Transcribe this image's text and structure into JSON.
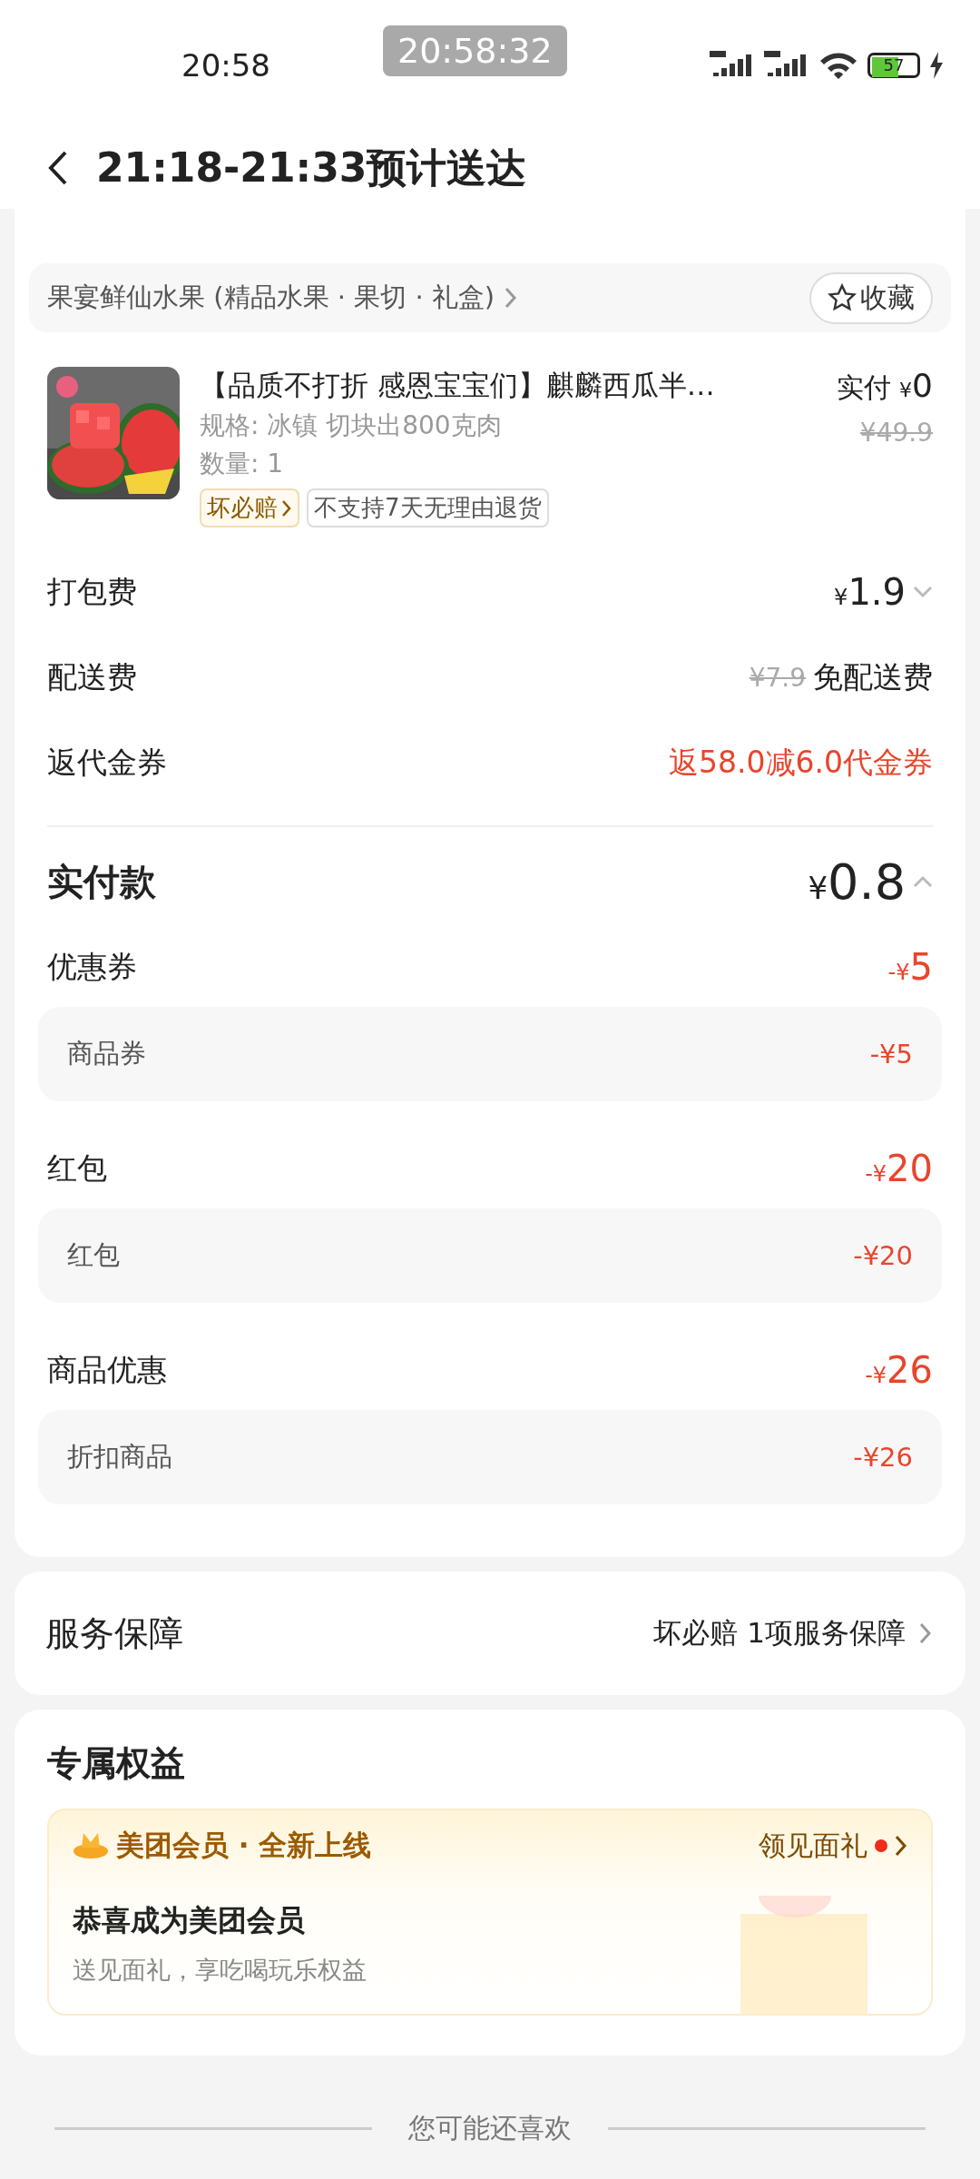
{
  "status_bar": {
    "time": "20:58",
    "screen_clock": "20:58:32",
    "battery": "57"
  },
  "header": {
    "title": "21:18-21:33预计送达"
  },
  "shop": {
    "name": "果宴鲜仙水果 (精品水果 · 果切 · 礼盒)",
    "favorite_button": "收藏"
  },
  "product": {
    "title": "【品质不打折 感恩宝宝们】麒麟西瓜半…",
    "spec": "规格: 冰镇 切块出800克肉",
    "quantity": "数量: 1",
    "tags": [
      {
        "label": "坏必赔",
        "kind": "guarantee"
      },
      {
        "label": "不支持7天无理由退货",
        "kind": "plain"
      }
    ],
    "paid_label": "实付",
    "currency": "¥",
    "amount": "0",
    "original_price": "¥49.9"
  },
  "fees": [
    {
      "kind": "price",
      "label": "打包费",
      "currency": "¥",
      "amount": "1.9",
      "expanded": false
    },
    {
      "kind": "free",
      "label": "配送费",
      "old_price": "¥7.9",
      "value": "免配送费"
    },
    {
      "kind": "promo",
      "label": "返代金券",
      "value": "返58.0减6.0代金券"
    }
  ],
  "total": {
    "label": "实付款",
    "currency": "¥",
    "amount": "0.8",
    "expanded": true
  },
  "discounts": [
    {
      "label": "优惠券",
      "sign": "-¥",
      "amount": "5",
      "items": [
        {
          "label": "商品券",
          "value": "-¥5"
        }
      ]
    },
    {
      "label": "红包",
      "sign": "-¥",
      "amount": "20",
      "items": [
        {
          "label": "红包",
          "value": "-¥20"
        }
      ]
    },
    {
      "label": "商品优惠",
      "sign": "-¥",
      "amount": "26",
      "items": [
        {
          "label": "折扣商品",
          "value": "-¥26"
        }
      ]
    }
  ],
  "service": {
    "title": "服务保障",
    "value": "坏必赔 1项服务保障"
  },
  "benefits": {
    "title": "专属权益",
    "brand": "美团会员 · 全新上线",
    "link": "领见面礼",
    "link_dot": true,
    "headline": "恭喜成为美团会员",
    "subtitle": "送见面礼，享吃喝玩乐权益"
  },
  "recommend": {
    "title": "您可能还喜欢"
  }
}
